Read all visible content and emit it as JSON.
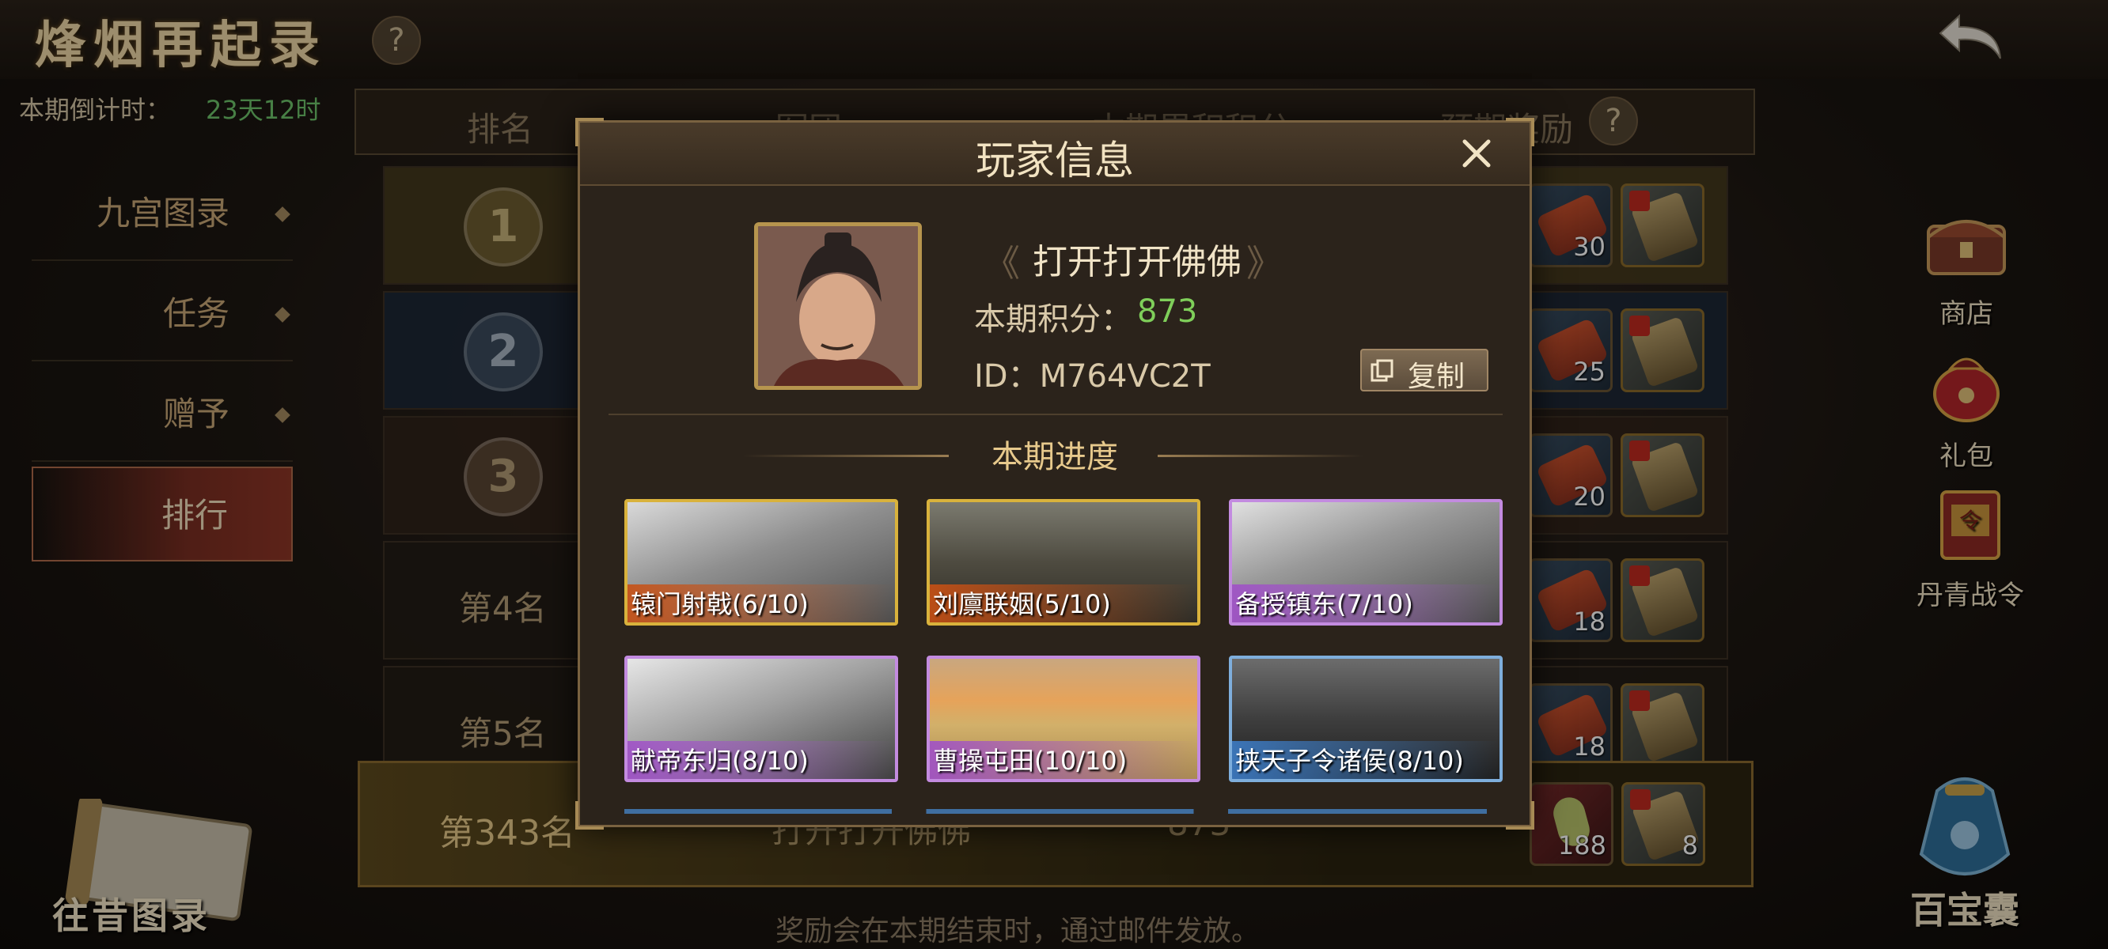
{
  "header": {
    "title": "烽烟再起录",
    "countdown_label": "本期倒计时：",
    "countdown_value": "23天12时"
  },
  "left_menu": {
    "items": [
      {
        "label": "九宫图录",
        "active": false
      },
      {
        "label": "任务",
        "active": false
      },
      {
        "label": "赠予",
        "active": false
      },
      {
        "label": "排行",
        "active": true
      }
    ]
  },
  "table": {
    "headers": [
      "排名",
      "军团",
      "本期累积积分",
      "预期奖励"
    ],
    "rows": [
      {
        "rank": "1",
        "rewards": [
          "30",
          ""
        ]
      },
      {
        "rank": "2",
        "rewards": [
          "25",
          ""
        ]
      },
      {
        "rank": "3",
        "rewards": [
          "20",
          ""
        ]
      },
      {
        "rank": "第4名",
        "rewards": [
          "18",
          ""
        ]
      },
      {
        "rank": "第5名",
        "rewards": [
          "18",
          ""
        ]
      }
    ],
    "my_row": {
      "rank": "第343名",
      "name": "打开打开佛佛",
      "score": "873",
      "rewards": [
        "188",
        "8"
      ]
    }
  },
  "side_buttons": [
    {
      "label": "商店",
      "icon": "chest-icon"
    },
    {
      "label": "礼包",
      "icon": "gift-bag-icon"
    },
    {
      "label": "丹青战令",
      "icon": "war-order-icon"
    }
  ],
  "treasure_bag_label": "百宝囊",
  "past_records_label": "往昔图录",
  "footer_note": "奖励会在本期结束时，通过邮件发放。",
  "modal": {
    "title": "玩家信息",
    "player_name": "打开打开佛佛",
    "score_label": "本期积分：",
    "score_value": "873",
    "id_text": "ID：M764VC2T",
    "copy_label": "复制",
    "progress_title": "本期进度",
    "cards": [
      {
        "label": "辕门射戟(6/10)",
        "frame": "gold"
      },
      {
        "label": "刘廪联姻(5/10)",
        "frame": "gold"
      },
      {
        "label": "备授镇东(7/10)",
        "frame": "purple"
      },
      {
        "label": "献帝东归(8/10)",
        "frame": "purple"
      },
      {
        "label": "曹操屯田(10/10)",
        "frame": "purple"
      },
      {
        "label": "挟天子令诸侯(8/10)",
        "frame": "blue"
      }
    ]
  },
  "colors": {
    "accent_gold": "#d9b23c",
    "score_green": "#7fcf5a",
    "countdown_green": "#6ec46a"
  }
}
